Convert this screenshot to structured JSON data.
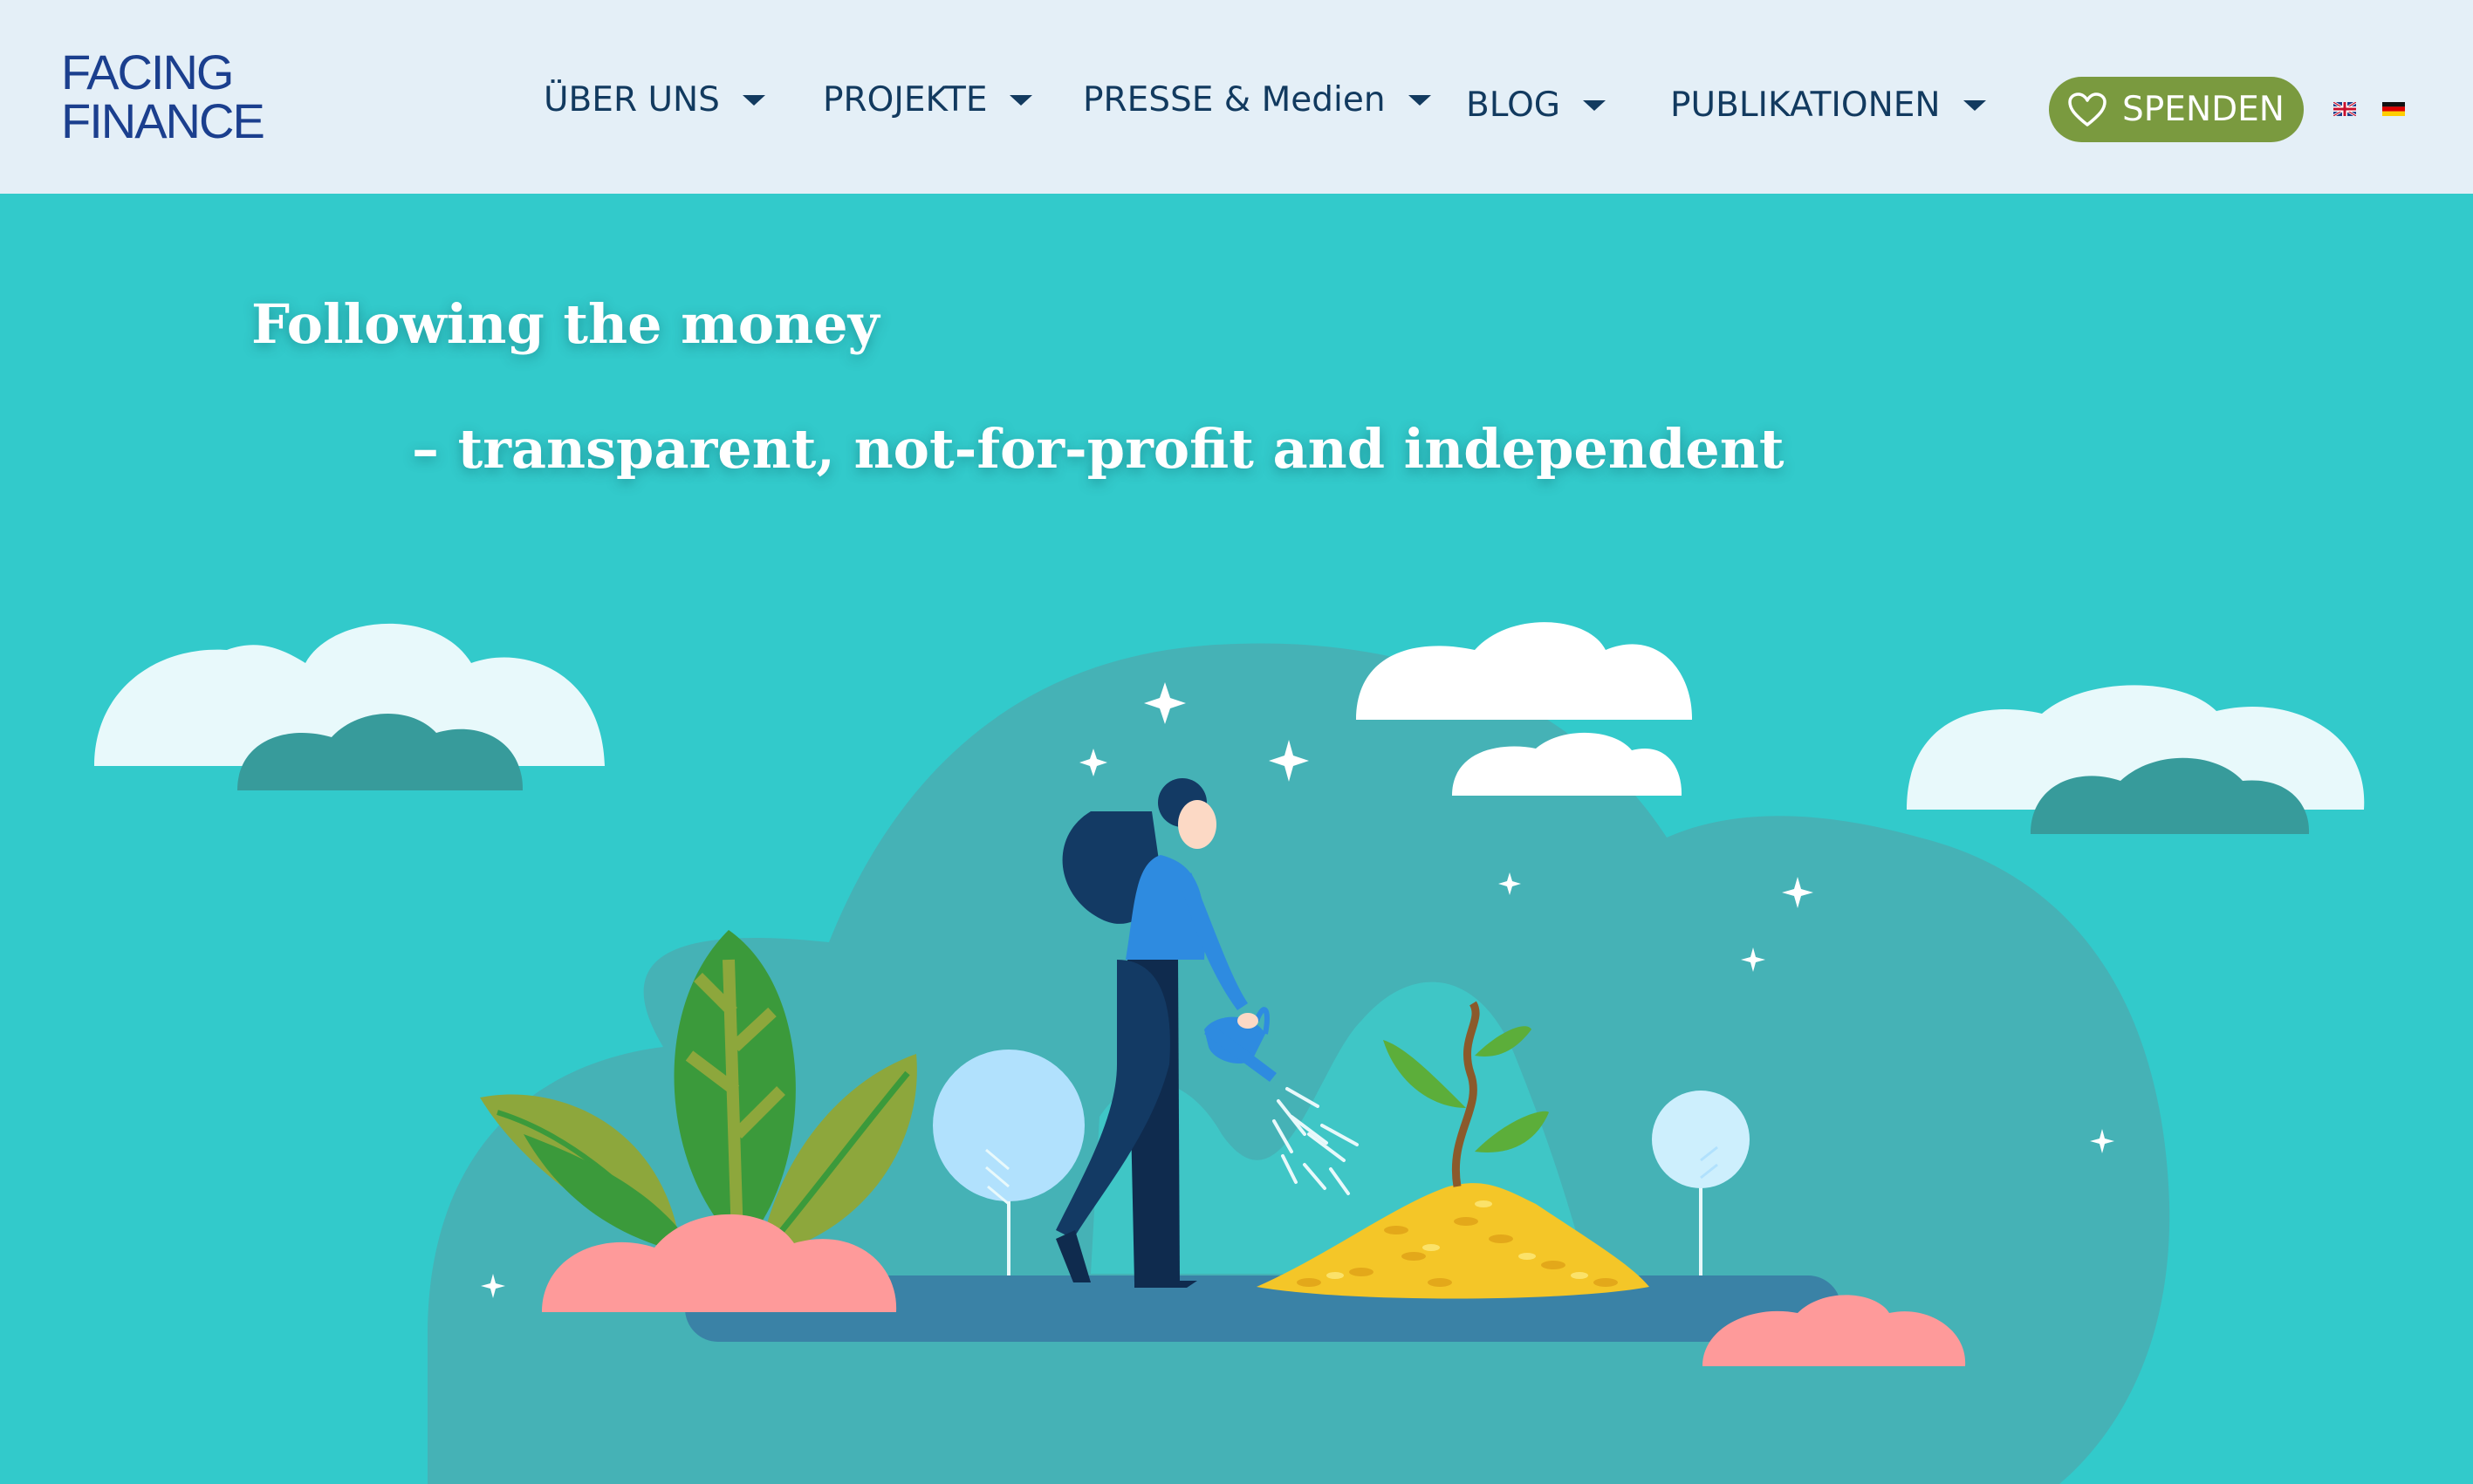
{
  "brand": {
    "logo_line1": "FACING",
    "logo_line2": "FINANCE",
    "logo_alt": "Facing Finance"
  },
  "nav": {
    "items": [
      {
        "label": "ÜBER UNS"
      },
      {
        "label": "PROJEKTE"
      },
      {
        "label": "PRESSE & Medien"
      },
      {
        "label": "BLOG"
      },
      {
        "label": "PUBLIKATIONEN"
      }
    ],
    "donate_label": "SPENDEN",
    "languages": [
      "English",
      "Deutsch"
    ]
  },
  "hero": {
    "title": "Following the money",
    "subtitle": "– transparent, not-for-profit and independent"
  },
  "colors": {
    "header_bg": "#e4eff7",
    "nav_text": "#123a5f",
    "hero_bg": "#32cacb",
    "donate_bg": "#7a9a3f",
    "hill": "#45b2b6",
    "ground": "#3a82a6",
    "coins": "#f4c628",
    "bush": "#fe9a9a"
  },
  "icons": [
    "heart-icon",
    "caret-down-icon",
    "flag-uk-icon",
    "flag-de-icon"
  ]
}
